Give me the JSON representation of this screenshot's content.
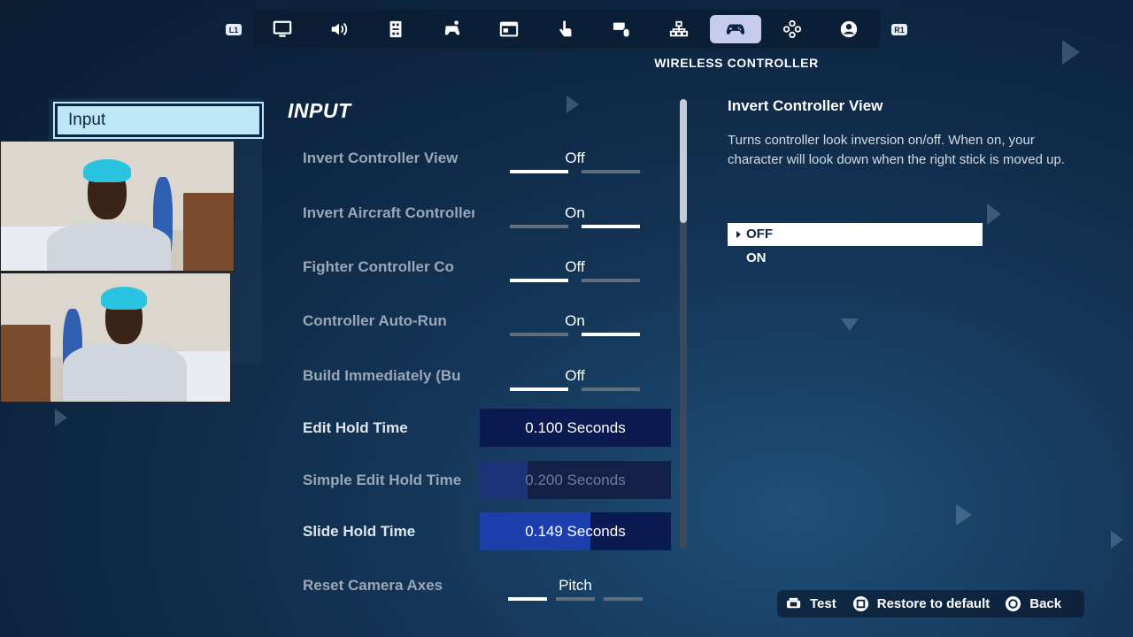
{
  "header": {
    "left_bumper": "L1",
    "right_bumper": "R1",
    "tabs": [
      {
        "icon": "monitor-icon"
      },
      {
        "icon": "speaker-icon"
      },
      {
        "icon": "accessibility-icon"
      },
      {
        "icon": "controller-touch-icon"
      },
      {
        "icon": "window-icon"
      },
      {
        "icon": "touch-icon"
      },
      {
        "icon": "keyboard-mouse-icon"
      },
      {
        "icon": "hierarchy-icon"
      },
      {
        "icon": "gamepad-icon",
        "active": true
      },
      {
        "icon": "dpad-icon"
      },
      {
        "icon": "account-icon"
      }
    ],
    "active_tab_title": "WIRELESS CONTROLLER"
  },
  "sidebar": {
    "selected_category": "Input"
  },
  "main": {
    "section_title": "INPUT",
    "toggles": [
      {
        "label": "Invert Controller View",
        "value": "Off"
      },
      {
        "label": "Invert Aircraft Controller",
        "value": "On"
      },
      {
        "label": "Fighter Controller Co",
        "value": "Off"
      },
      {
        "label": "Controller Auto-Run",
        "value": "On"
      },
      {
        "label": "Build Immediately (Bu",
        "value": "Off"
      }
    ],
    "sliders": [
      {
        "label": "Edit Hold Time",
        "value": "0.100 Seconds",
        "fraction": 0.0
      },
      {
        "label": "Simple Edit Hold Time",
        "value": "0.200 Seconds",
        "fraction": 0.25
      },
      {
        "label": "Slide Hold Time",
        "value": "0.149 Seconds",
        "fraction": 0.58
      }
    ],
    "multi": {
      "label": "Reset Camera Axes",
      "value": "Pitch",
      "options_count": 3,
      "selected_index": 0
    }
  },
  "detail": {
    "title": "Invert Controller View",
    "description": "Turns controller look inversion on/off.  When on, your character will look down when the right stick is moved up.",
    "options": [
      "OFF",
      "ON"
    ],
    "selected": "OFF"
  },
  "footer": {
    "test_label": "Test",
    "restore_label": "Restore to default",
    "back_label": "Back"
  },
  "colors": {
    "accent_tab": "#c7ccec",
    "category_highlight": "#bde6f7",
    "slider_fill": "#1d3fae"
  }
}
